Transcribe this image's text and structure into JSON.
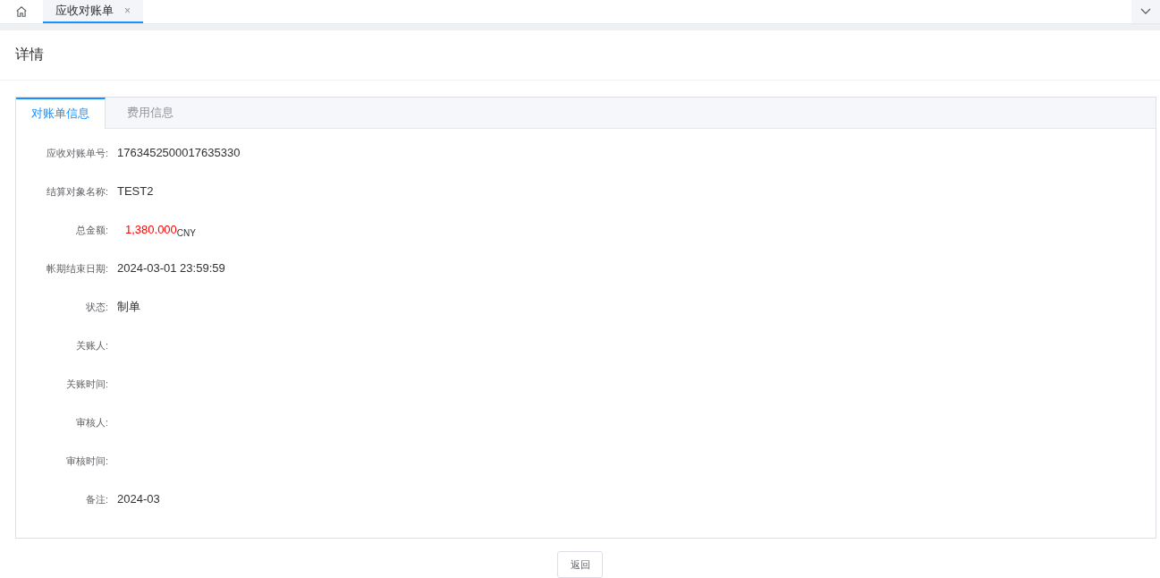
{
  "tab_bar": {
    "tabs": [
      {
        "label": "应收对账单",
        "selected": true,
        "close": "×"
      }
    ]
  },
  "page": {
    "title": "详情"
  },
  "card": {
    "tabs": [
      {
        "label": "对账单信息",
        "selected": true
      },
      {
        "label": "费用信息",
        "selected": false
      }
    ],
    "fields": [
      {
        "kind": "text",
        "label": "应收对账单号:",
        "value": "1763452500017635330"
      },
      {
        "kind": "text",
        "label": "结算对象名称:",
        "value": "TEST2"
      },
      {
        "kind": "amount",
        "label": "总金额:",
        "value": "1,380.000",
        "currency": "CNY"
      },
      {
        "kind": "text",
        "label": "帐期结束日期:",
        "value": "2024-03-01 23:59:59"
      },
      {
        "kind": "text",
        "label": "状态:",
        "value": "制单"
      },
      {
        "kind": "text",
        "label": "关账人:"
      },
      {
        "kind": "text",
        "label": "关账时间:"
      },
      {
        "kind": "text",
        "label": "审核人:"
      },
      {
        "kind": "text",
        "label": "审核时间:"
      },
      {
        "kind": "text",
        "label": "备注:",
        "value": "2024-03"
      }
    ]
  },
  "footer": {
    "button": "返回"
  }
}
